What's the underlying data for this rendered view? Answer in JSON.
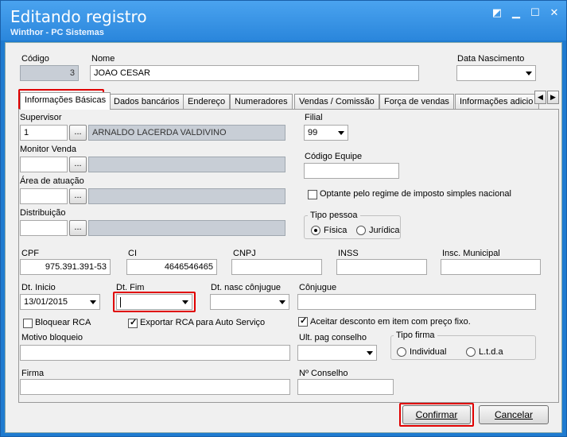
{
  "window": {
    "title": "Editando registro",
    "subtitle": "Winthor - PC Sistemas"
  },
  "header": {
    "codigo_label": "Código",
    "codigo_value": "3",
    "nome_label": "Nome",
    "nome_value": "JOAO CESAR",
    "nascimento_label": "Data Nascimento",
    "nascimento_value": ""
  },
  "tabs": [
    "Informações Básicas",
    "Dados bancários",
    "Endereço",
    "Numeradores",
    "Vendas  / Comissão",
    "Força de vendas",
    "Informações adicio"
  ],
  "form": {
    "supervisor_label": "Supervisor",
    "supervisor_code": "1",
    "supervisor_name": "ARNALDO LACERDA VALDIVINO",
    "monitor_label": "Monitor Venda",
    "area_label": "Área de atuação",
    "distribuicao_label": "Distribuição",
    "ellipsis": "...",
    "filial_label": "Filial",
    "filial_value": "99",
    "codigo_equipe_label": "Código Equipe",
    "simples_label": "Optante pelo regime de imposto simples nacional",
    "tipo_pessoa_label": "Tipo pessoa",
    "fisica_label": "Física",
    "juridica_label": "Jurídica",
    "cpf_label": "CPF",
    "cpf_value": "975.391.391-53",
    "ci_label": "CI",
    "ci_value": "4646546465",
    "cnpj_label": "CNPJ",
    "inss_label": "INSS",
    "insc_label": "Insc. Municipal",
    "dt_inicio_label": "Dt. Inicio",
    "dt_inicio_value": "13/01/2015",
    "dt_fim_label": "Dt. Fim",
    "dt_nasc_conj_label": "Dt. nasc cônjugue",
    "conjugue_label": "Cônjugue",
    "bloquear_label": "Bloquear RCA",
    "exportar_label": "Exportar RCA para Auto Serviço",
    "aceitar_label": "Aceitar desconto em item com preço fixo.",
    "motivo_label": "Motivo bloqueio",
    "ult_pag_label": "Ult. pag conselho",
    "tipo_firma_label": "Tipo firma",
    "individual_label": "Individual",
    "ltda_label": "L.t.d.a",
    "firma_label": "Firma",
    "conselho_label": "Nº Conselho"
  },
  "buttons": {
    "confirmar": "Confirmar",
    "cancelar": "Cancelar"
  }
}
